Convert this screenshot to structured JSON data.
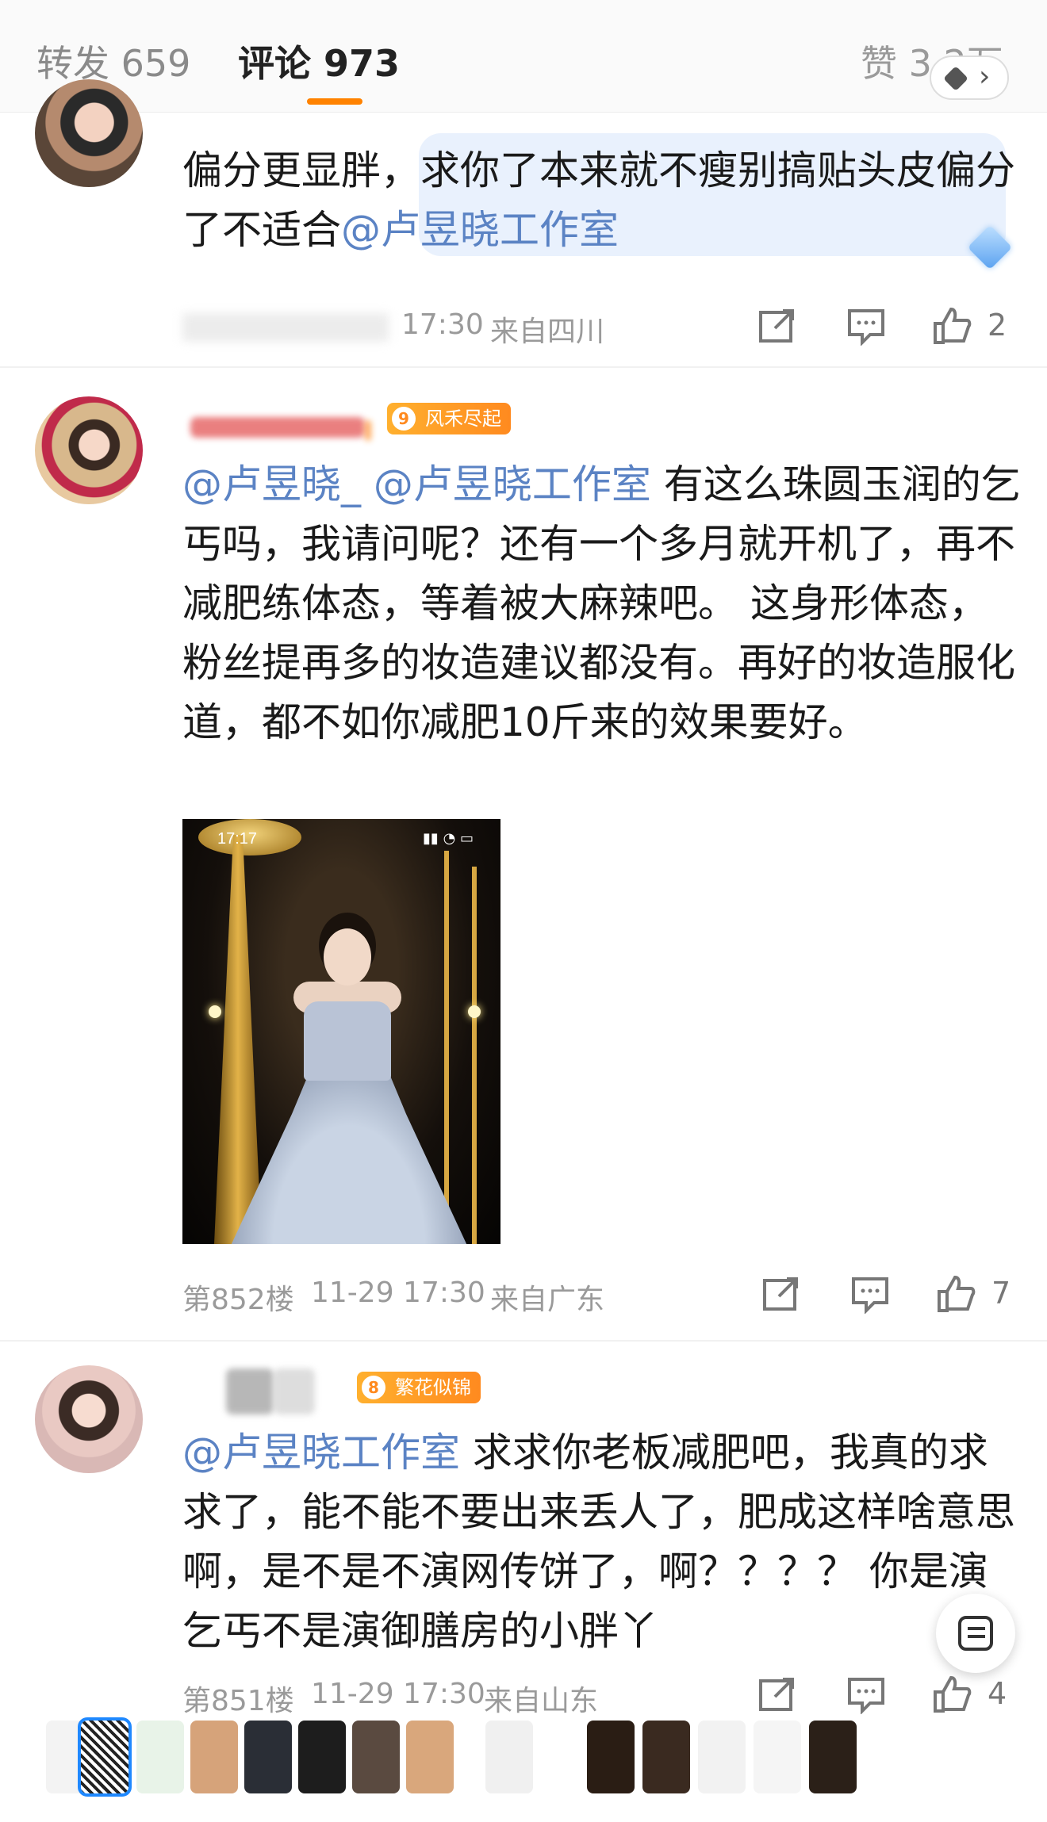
{
  "tabs": {
    "repost": "转发 659",
    "comment": "评论 973",
    "like": "赞 3.2万"
  },
  "comments": [
    {
      "text_plain": "偏分更显胖，求你了本来就不瘦别搞贴头皮偏分了不适合",
      "mention": "@卢昱晓工作室",
      "time": "17:30",
      "location": "来自四川",
      "likes": "2"
    },
    {
      "badge_level": "9",
      "badge_name": "风禾尽起",
      "mention1": "@卢昱晓_",
      "mention2": "@卢昱晓工作室",
      "text_plain": " 有这么珠圆玉润的乞丐吗，我请问呢？还有一个多月就开机了，再不减肥练体态，等着被大麻辣吧。 这身形体态，粉丝提再多的妆造建议都没有。再好的妆造服化道，都不如你减肥10斤来的效果要好。",
      "photo_time": "17:17",
      "floor": "第852楼",
      "date": "11-29 17:30",
      "location": "来自广东",
      "likes": "7"
    },
    {
      "badge_level": "8",
      "badge_name": "繁花似锦",
      "mention": "@卢昱晓工作室",
      "text_plain": " 求求你老板减肥吧，我真的求求了，能不能不要出来丢人了，肥成这样啥意思啊，是不是不演网传饼了，啊？？？？ 你是演乞丐不是演御膳房的小胖丫",
      "floor": "第851楼",
      "date": "11-29 17:30",
      "location": "来自山东",
      "likes": "4"
    }
  ],
  "colors": {
    "accent": "#ff8200",
    "mention": "#5b83c4",
    "badge": "#ff8a1f"
  },
  "icons": [
    "share-icon",
    "comment-icon",
    "like-icon",
    "scan-text-icon",
    "cube-icon",
    "chevron-right-icon"
  ]
}
